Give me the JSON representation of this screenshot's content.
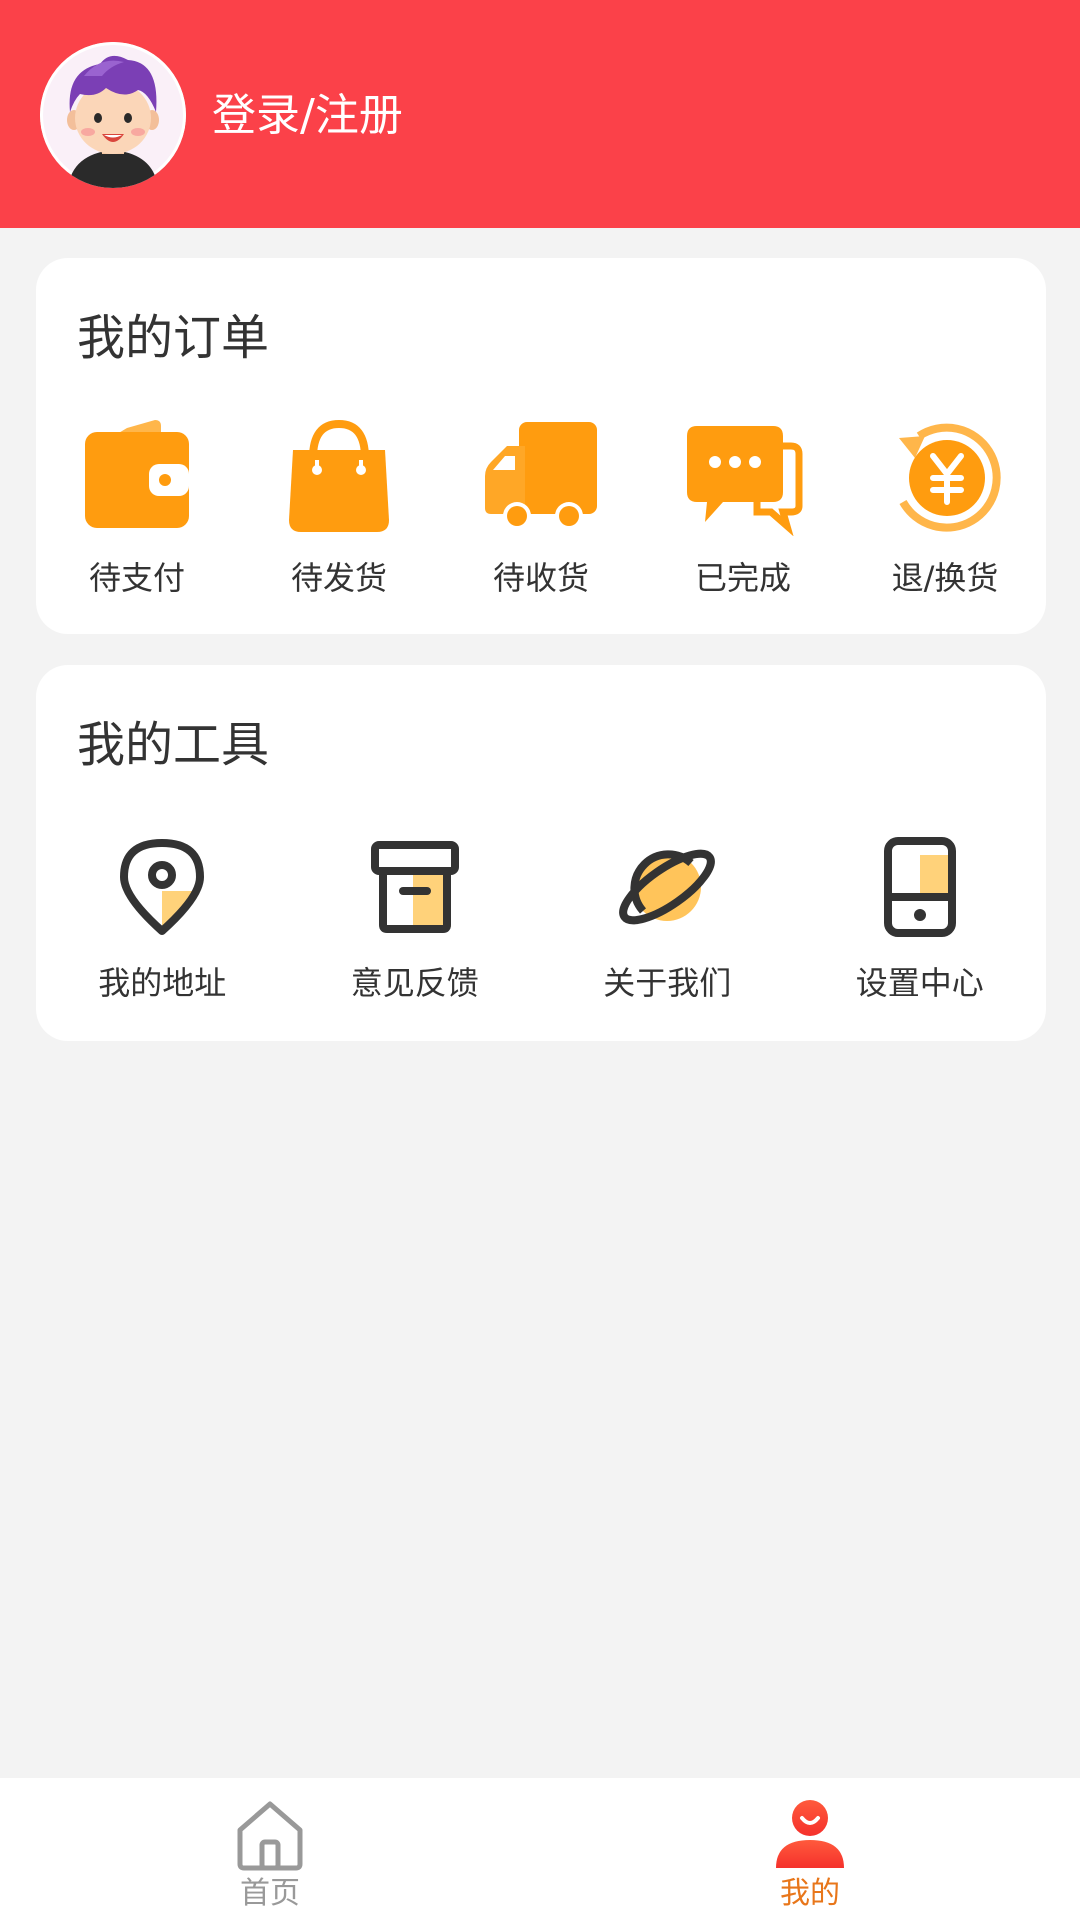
{
  "header": {
    "login_text": "登录/注册",
    "background_color": "#fb4149"
  },
  "orders": {
    "title": "我的订单",
    "items": [
      {
        "label": "待支付",
        "icon": "wallet-icon"
      },
      {
        "label": "待发货",
        "icon": "shopping-bag-icon"
      },
      {
        "label": "待收货",
        "icon": "truck-icon"
      },
      {
        "label": "已完成",
        "icon": "chat-bubbles-icon"
      },
      {
        "label": "退/换货",
        "icon": "refund-yuan-icon"
      }
    ],
    "icon_color": "#ff9c0f"
  },
  "tools": {
    "title": "我的工具",
    "items": [
      {
        "label": "我的地址",
        "icon": "location-pin-icon"
      },
      {
        "label": "意见反馈",
        "icon": "archive-box-icon"
      },
      {
        "label": "关于我们",
        "icon": "planet-icon"
      },
      {
        "label": "设置中心",
        "icon": "phone-device-icon"
      }
    ]
  },
  "tabbar": {
    "tabs": [
      {
        "label": "首页",
        "icon": "home-icon",
        "active": false
      },
      {
        "label": "我的",
        "icon": "user-icon",
        "active": true
      }
    ],
    "active_color": "#e8761a",
    "inactive_color": "#999999"
  }
}
